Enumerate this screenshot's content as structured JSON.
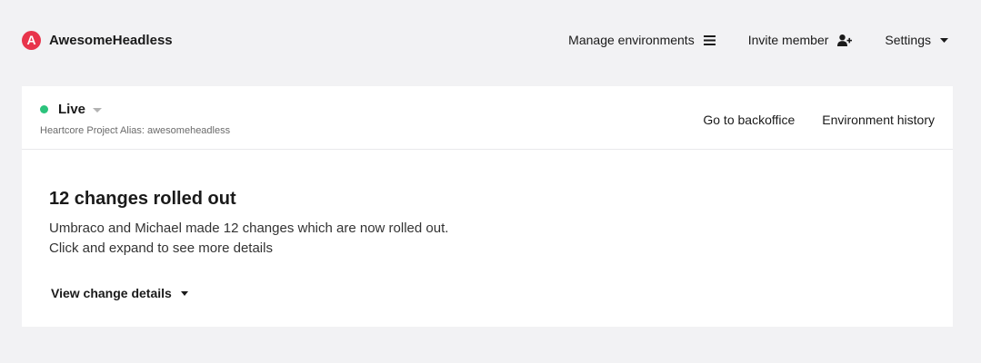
{
  "brand": {
    "logo_letter": "A",
    "name": "AwesomeHeadless",
    "logo_color": "#e8344b"
  },
  "nav": {
    "manage_label": "Manage environments",
    "manage_icon": "hamburger-menu-icon",
    "invite_label": "Invite member",
    "invite_icon": "add-user-icon",
    "settings_label": "Settings",
    "settings_icon": "caret-down-icon"
  },
  "environment": {
    "name": "Live",
    "status_color": "#2bc37c",
    "alias_text": "Heartcore Project Alias: awesomeheadless"
  },
  "card_links": {
    "backoffice_label": "Go to backoffice",
    "history_label": "Environment history"
  },
  "rollout": {
    "title": "12 changes rolled out",
    "line1": "Umbraco and Michael made 12 changes which are now rolled out.",
    "line2": "Click and expand to see more details",
    "details_label": "View change details"
  }
}
